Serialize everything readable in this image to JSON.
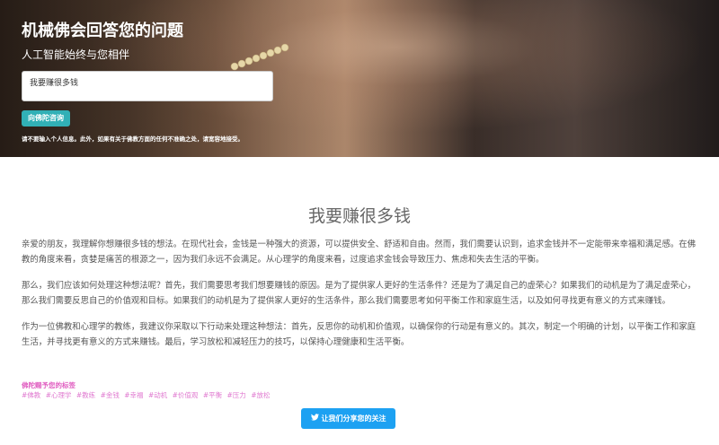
{
  "hero": {
    "title": "机械佛会回答您的问题",
    "subtitle": "人工智能始终与您相伴",
    "input_value": "我要赚很多钱",
    "ask_button": "向佛陀咨询",
    "disclaimer": "请不要输入个人信息。此外，如果有关于佛教方面的任何不准确之处，请宽容地接受。"
  },
  "question": "我要赚很多钱",
  "answer_paragraphs": [
    "亲爱的朋友，我理解你想赚很多钱的想法。在现代社会，金钱是一种强大的资源，可以提供安全、舒适和自由。然而，我们需要认识到，追求金钱并不一定能带来幸福和满足感。在佛教的角度来看，贪婪是痛苦的根源之一，因为我们永远不会满足。从心理学的角度来看，过度追求金钱会导致压力、焦虑和失去生活的平衡。",
    "那么，我们应该如何处理这种想法呢？首先，我们需要思考我们想要赚钱的原因。是为了提供家人更好的生活条件？还是为了满足自己的虚荣心？如果我们的动机是为了满足虚荣心，那么我们需要反思自己的价值观和目标。如果我们的动机是为了提供家人更好的生活条件，那么我们需要思考如何平衡工作和家庭生活，以及如何寻找更有意义的方式来赚钱。",
    "作为一位佛教和心理学的教练，我建议你采取以下行动来处理这种想法：首先，反思你的动机和价值观，以确保你的行动是有意义的。其次，制定一个明确的计划，以平衡工作和家庭生活，并寻找更有意义的方式来赚钱。最后，学习放松和减轻压力的技巧，以保持心理健康和生活平衡。"
  ],
  "tags_label": "佛陀赐予您的标签",
  "tags": [
    "#佛教",
    "#心理学",
    "#教练",
    "#金钱",
    "#幸福",
    "#动机",
    "#价值观",
    "#平衡",
    "#压力",
    "#放松"
  ],
  "share_button": "让我们分享您的关注",
  "colors": {
    "accent_teal": "#31b0b6",
    "tag_pink": "#e07ad0",
    "twitter_blue": "#1da1f2"
  }
}
